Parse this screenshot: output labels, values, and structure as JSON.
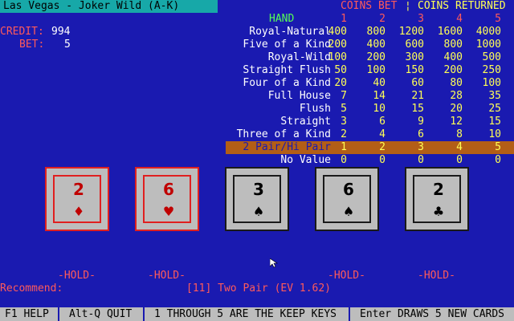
{
  "title": "Las Vegas - Joker Wild (A-K)",
  "credit": {
    "label": "CREDIT:",
    "value": "994"
  },
  "bet": {
    "label": "BET:",
    "value": "5"
  },
  "paytable": {
    "coins_bet": "COINS BET",
    "divider": "¦",
    "coins_returned": "COINS RETURNED",
    "hand_header": "HAND",
    "columns": [
      "1",
      "2",
      "3",
      "4",
      "5"
    ],
    "rows": [
      {
        "name": "Royal-Natural",
        "values": [
          "400",
          "800",
          "1200",
          "1600",
          "4000"
        ]
      },
      {
        "name": "Five of a Kind",
        "values": [
          "200",
          "400",
          "600",
          "800",
          "1000"
        ]
      },
      {
        "name": "Royal-Wild",
        "values": [
          "100",
          "200",
          "300",
          "400",
          "500"
        ]
      },
      {
        "name": "Straight Flush",
        "values": [
          "50",
          "100",
          "150",
          "200",
          "250"
        ]
      },
      {
        "name": "Four of a Kind",
        "values": [
          "20",
          "40",
          "60",
          "80",
          "100"
        ]
      },
      {
        "name": "Full House",
        "values": [
          "7",
          "14",
          "21",
          "28",
          "35"
        ]
      },
      {
        "name": "Flush",
        "values": [
          "5",
          "10",
          "15",
          "20",
          "25"
        ]
      },
      {
        "name": "Straight",
        "values": [
          "3",
          "6",
          "9",
          "12",
          "15"
        ]
      },
      {
        "name": "Three of a Kind",
        "values": [
          "2",
          "4",
          "6",
          "8",
          "10"
        ]
      },
      {
        "name": "2 Pair/Hi Pair",
        "values": [
          "1",
          "2",
          "3",
          "4",
          "5"
        ]
      },
      {
        "name": "No Value",
        "values": [
          "0",
          "0",
          "0",
          "0",
          "0"
        ]
      }
    ]
  },
  "cards": [
    {
      "rank": "2",
      "suit": "♦",
      "color": "red"
    },
    {
      "rank": "6",
      "suit": "♥",
      "color": "red"
    },
    {
      "rank": "3",
      "suit": "♠",
      "color": "black"
    },
    {
      "rank": "6",
      "suit": "♠",
      "color": "black"
    },
    {
      "rank": "2",
      "suit": "♣",
      "color": "black"
    }
  ],
  "holds": [
    "-HOLD-",
    "-HOLD-",
    "",
    "-HOLD-",
    "-HOLD-"
  ],
  "recommend": {
    "label": "Recommend:",
    "text": "[11] Two Pair (EV 1.62)"
  },
  "footer": {
    "help": "F1 HELP",
    "quit": "Alt-Q QUIT",
    "keys": "1 THROUGH 5 ARE THE KEEP KEYS",
    "draw": "Enter DRAWS 5 NEW CARDS"
  }
}
